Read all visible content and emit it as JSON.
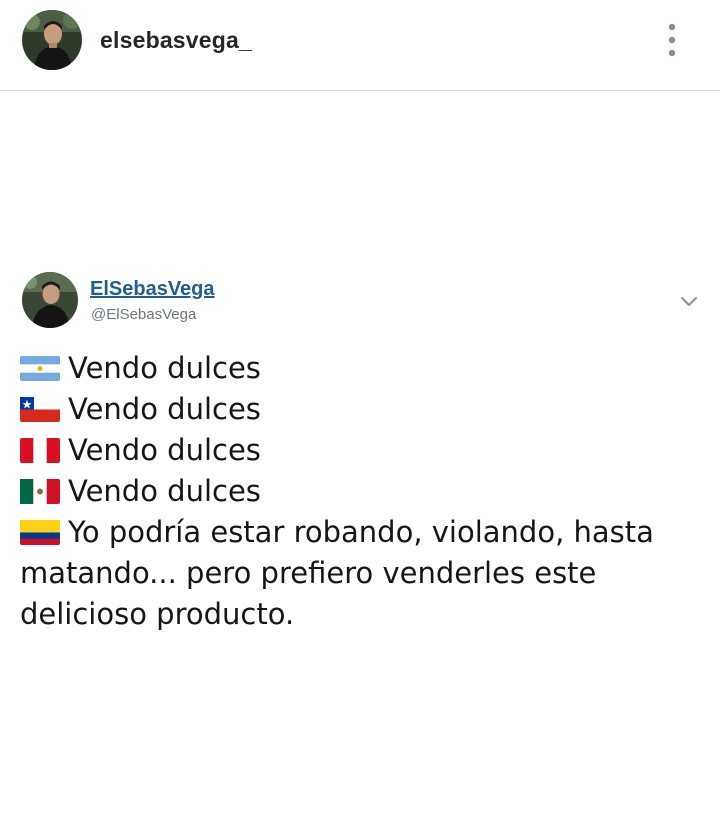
{
  "post_header": {
    "username": "elsebasvega_",
    "more_icon": "vertical-ellipsis-icon"
  },
  "tweet": {
    "display_name": "ElSebasVega",
    "handle": "@ElSebasVega",
    "menu_icon": "chevron-down-icon",
    "lines": [
      {
        "flag": "argentina-flag-icon",
        "text": "Vendo dulces"
      },
      {
        "flag": "chile-flag-icon",
        "text": "Vendo dulces"
      },
      {
        "flag": "peru-flag-icon",
        "text": "Vendo dulces"
      },
      {
        "flag": "mexico-flag-icon",
        "text": "Vendo dulces"
      },
      {
        "flag": "colombia-flag-icon",
        "text": "Yo podría estar robando, violando, hasta matando... pero prefiero venderles este delicioso producto."
      }
    ]
  },
  "colors": {
    "name_link": "#1f5f8f",
    "handle": "#6b7780",
    "divider": "#dbdbdb"
  }
}
